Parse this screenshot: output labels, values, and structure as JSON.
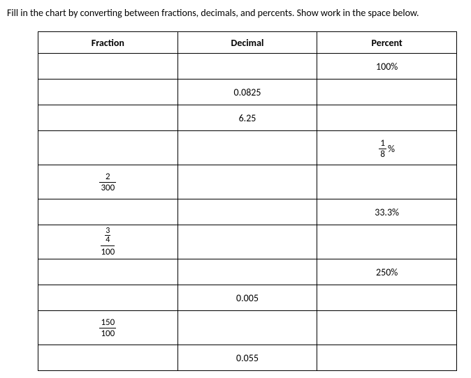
{
  "instruction": "Fill in the chart by converting between fractions, decimals, and percents.  Show work in the space below.",
  "headers": {
    "fraction": "Fraction",
    "decimal": "Decimal",
    "percent": "Percent"
  },
  "chart_data": {
    "type": "table",
    "columns": [
      "Fraction",
      "Decimal",
      "Percent"
    ],
    "rows": [
      {
        "fraction": "",
        "decimal": "",
        "percent": "100%"
      },
      {
        "fraction": "",
        "decimal": "0.0825",
        "percent": ""
      },
      {
        "fraction": "",
        "decimal": "6.25",
        "percent": ""
      },
      {
        "fraction": "",
        "decimal": "",
        "percent": "1/8 %"
      },
      {
        "fraction": "2/300",
        "decimal": "",
        "percent": ""
      },
      {
        "fraction": "",
        "decimal": "",
        "percent": "33.3%"
      },
      {
        "fraction": "(3/4)/100",
        "decimal": "",
        "percent": ""
      },
      {
        "fraction": "",
        "decimal": "",
        "percent": "250%"
      },
      {
        "fraction": "",
        "decimal": "0.005",
        "percent": ""
      },
      {
        "fraction": "150/100",
        "decimal": "",
        "percent": ""
      },
      {
        "fraction": "",
        "decimal": "0.055",
        "percent": ""
      }
    ]
  },
  "cells": {
    "r0_percent": "100%",
    "r1_decimal": "0.0825",
    "r2_decimal": "6.25",
    "r3_percent_num": "1",
    "r3_percent_den": "8",
    "r3_percent_sym": "%",
    "r4_frac_num": "2",
    "r4_frac_den": "300",
    "r5_percent": "33.3%",
    "r6_inner_num": "3",
    "r6_inner_den": "4",
    "r6_outer_den": "100",
    "r7_percent": "250%",
    "r8_decimal": "0.005",
    "r9_frac_num": "150",
    "r9_frac_den": "100",
    "r10_decimal": "0.055"
  }
}
